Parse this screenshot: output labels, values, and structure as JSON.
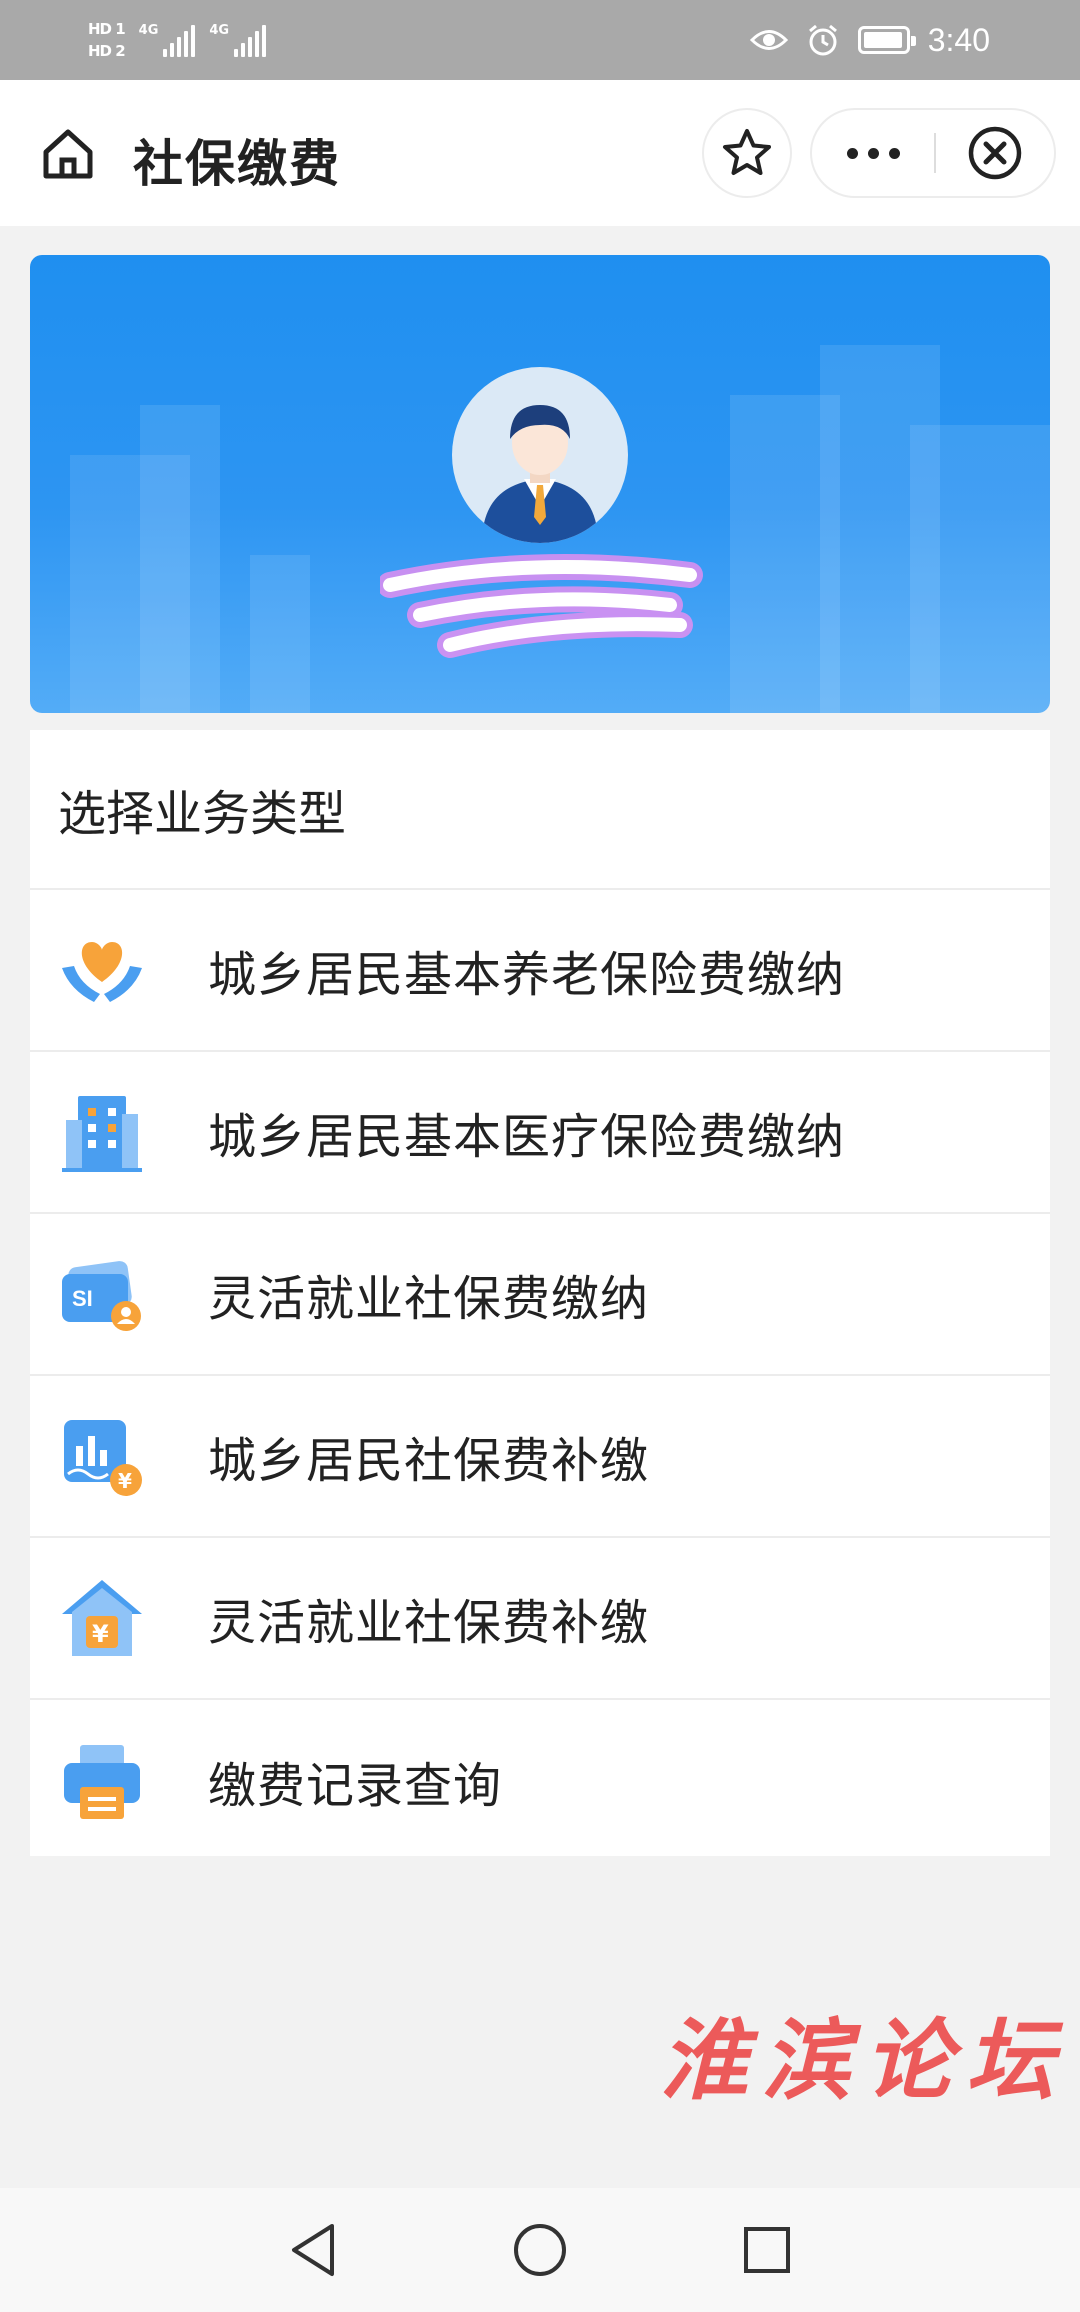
{
  "status_bar": {
    "hd1": "HD 1",
    "hd2": "HD 2",
    "network1": "4G",
    "network2": "4G",
    "time": "3:40"
  },
  "nav": {
    "title": "社保缴费"
  },
  "section": {
    "title": "选择业务类型",
    "items": [
      {
        "label": "城乡居民基本养老保险费缴纳",
        "icon": "heart-hands-icon"
      },
      {
        "label": "城乡居民基本医疗保险费缴纳",
        "icon": "building-icon"
      },
      {
        "label": "灵活就业社保费缴纳",
        "icon": "si-card-icon"
      },
      {
        "label": "城乡居民社保费补缴",
        "icon": "chart-yuan-icon"
      },
      {
        "label": "灵活就业社保费补缴",
        "icon": "house-yuan-icon"
      },
      {
        "label": "缴费记录查询",
        "icon": "printer-icon"
      }
    ]
  },
  "watermark": "淮滨论坛",
  "colors": {
    "banner": "#2d95f2",
    "icon_blue": "#4a9ef0",
    "icon_orange": "#f7a33a",
    "watermark": "#ec5a5a"
  }
}
